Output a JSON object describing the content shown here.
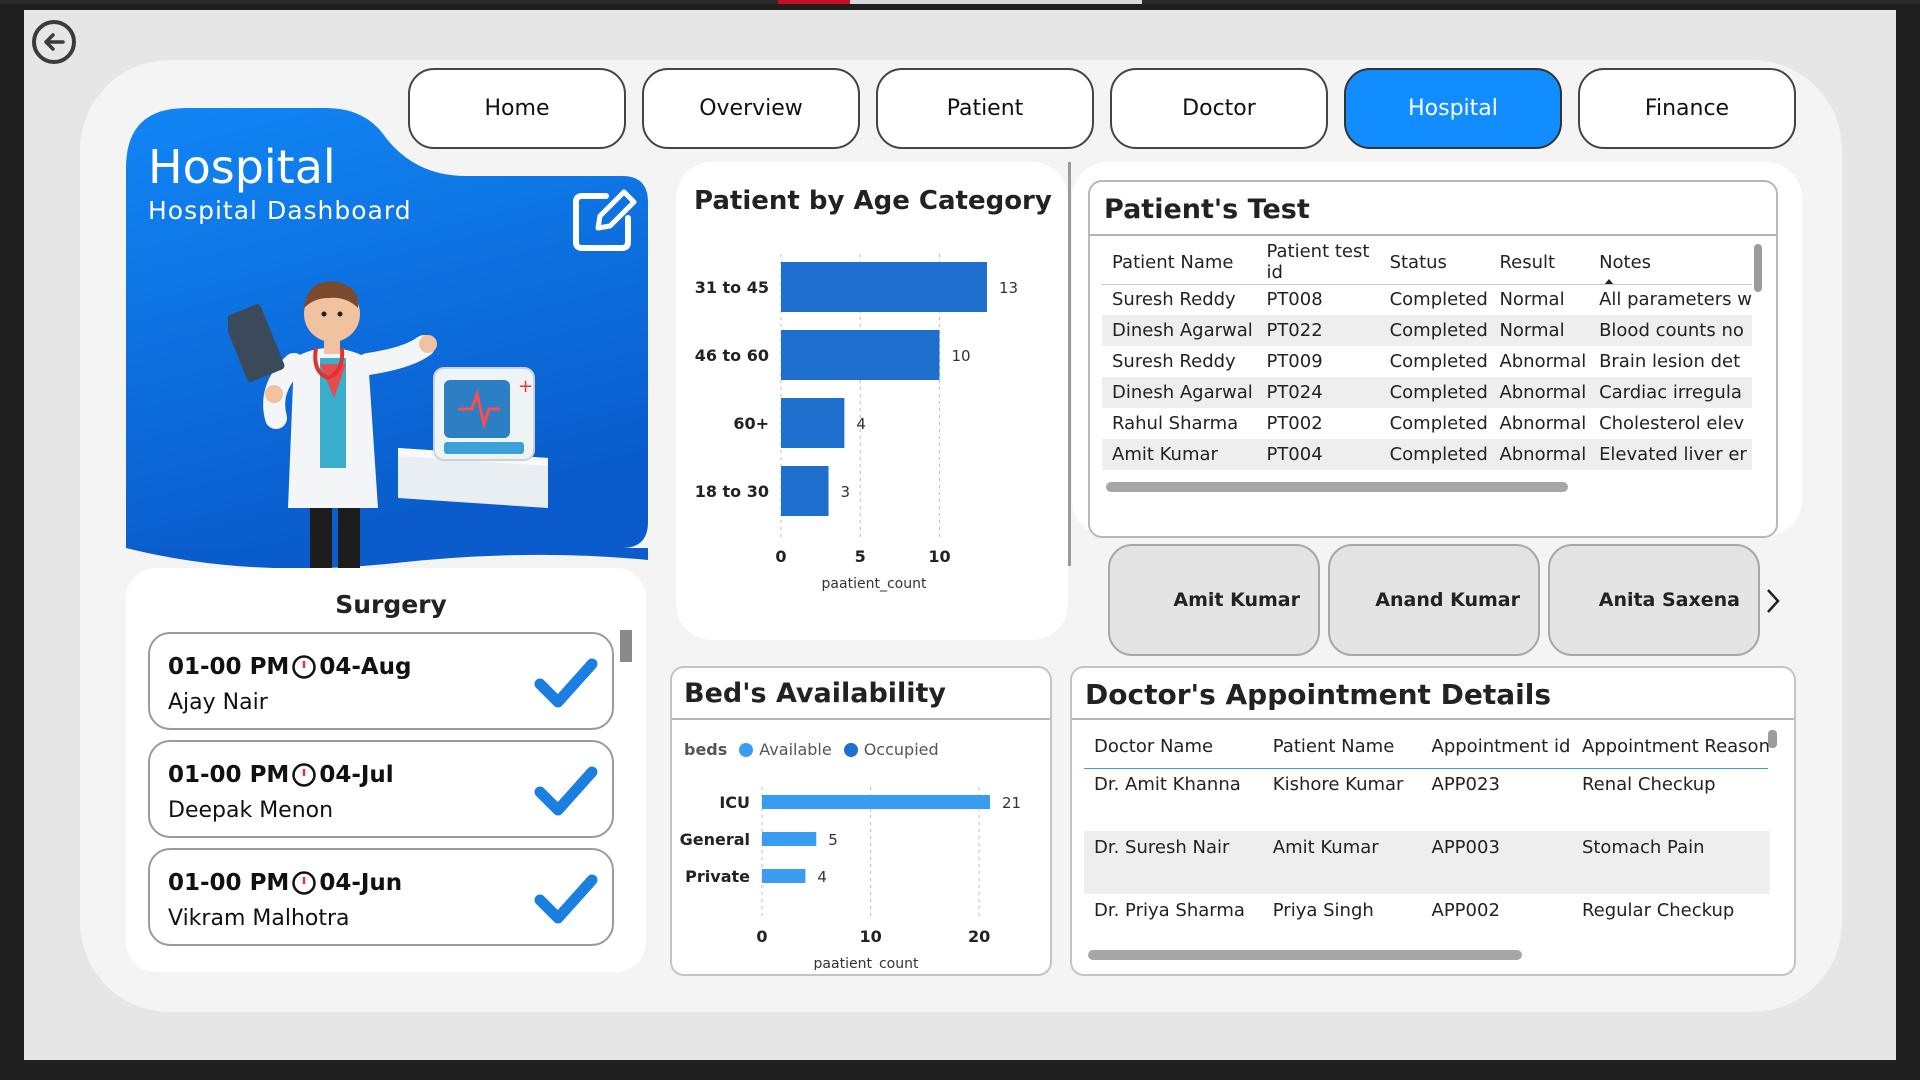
{
  "nav": {
    "tabs": [
      {
        "label": "Home"
      },
      {
        "label": "Overview"
      },
      {
        "label": "Patient"
      },
      {
        "label": "Doctor"
      },
      {
        "label": "Hospital",
        "active": true
      },
      {
        "label": "Finance"
      }
    ]
  },
  "hero": {
    "title": "Hospital",
    "subtitle": "Hospital  Dashboard"
  },
  "surgery": {
    "title": "Surgery",
    "items": [
      {
        "time": "01-00 PM",
        "date": "04-Aug",
        "name": "Ajay Nair"
      },
      {
        "time": "01-00 PM",
        "date": "04-Jul",
        "name": "Deepak Menon"
      },
      {
        "time": "01-00 PM",
        "date": "04-Jun",
        "name": "Vikram Malhotra"
      }
    ]
  },
  "age_chart": {
    "title": "Patient by Age Category",
    "xlabel": "paatient_count"
  },
  "bed_chart": {
    "title": "Bed's Availability",
    "legend_title": "beds",
    "legend": [
      "Available",
      "Occupied"
    ],
    "xlabel": "paatient_count"
  },
  "chart_data": [
    {
      "type": "bar",
      "orientation": "horizontal",
      "title": "Patient by Age Category",
      "xlabel": "paatient_count",
      "categories": [
        "31 to 45",
        "46 to 60",
        "60+",
        "18 to 30"
      ],
      "values": [
        13,
        10,
        4,
        3
      ],
      "xticks": [
        0,
        5,
        10
      ],
      "xlim": [
        0,
        13
      ],
      "color": "#1f6fcf"
    },
    {
      "type": "bar",
      "orientation": "horizontal",
      "title": "Bed's Availability",
      "xlabel": "paatient_count",
      "categories": [
        "ICU",
        "General",
        "Private"
      ],
      "values": [
        21,
        5,
        4
      ],
      "xticks": [
        0,
        10,
        20
      ],
      "xlim": [
        0,
        21
      ],
      "color": "#3a9cf0",
      "legend_title": "beds",
      "legend": [
        "Available",
        "Occupied"
      ]
    }
  ],
  "patient_test": {
    "title": "Patient's Test",
    "columns": [
      "Patient Name",
      "Patient test id",
      "Status",
      "Result",
      "Notes"
    ],
    "rows": [
      [
        "Suresh Reddy",
        "PT008",
        "Completed",
        "Normal",
        "All parameters w"
      ],
      [
        "Dinesh Agarwal",
        "PT022",
        "Completed",
        "Normal",
        "Blood counts no"
      ],
      [
        "Suresh Reddy",
        "PT009",
        "Completed",
        "Abnormal",
        "Brain lesion det"
      ],
      [
        "Dinesh Agarwal",
        "PT024",
        "Completed",
        "Abnormal",
        "Cardiac irregula"
      ],
      [
        "Rahul Sharma",
        "PT002",
        "Completed",
        "Abnormal",
        "Cholesterol elev"
      ],
      [
        "Amit Kumar",
        "PT004",
        "Completed",
        "Abnormal",
        "Elevated liver er"
      ]
    ]
  },
  "doctor_buttons": {
    "items": [
      "Amit Kumar",
      "Anand Kumar",
      "Anita Saxena"
    ]
  },
  "appointments": {
    "title": "Doctor's Appointment Details",
    "columns": [
      "Doctor Name",
      "Patient Name",
      "Appointment id",
      "Appointment Reason"
    ],
    "rows": [
      [
        "Dr. Amit Khanna",
        "Kishore Kumar",
        "APP023",
        "Renal Checkup"
      ],
      [
        "Dr. Suresh Nair",
        "Amit Kumar",
        "APP003",
        "Stomach Pain"
      ],
      [
        "Dr. Priya Sharma",
        "Priya Singh",
        "APP002",
        "Regular Checkup"
      ]
    ]
  },
  "colors": {
    "accent": "#118DFF",
    "bar_age": "#1f6fcf",
    "bar_bed": "#3a9cf0",
    "check": "#1a7fe0"
  }
}
